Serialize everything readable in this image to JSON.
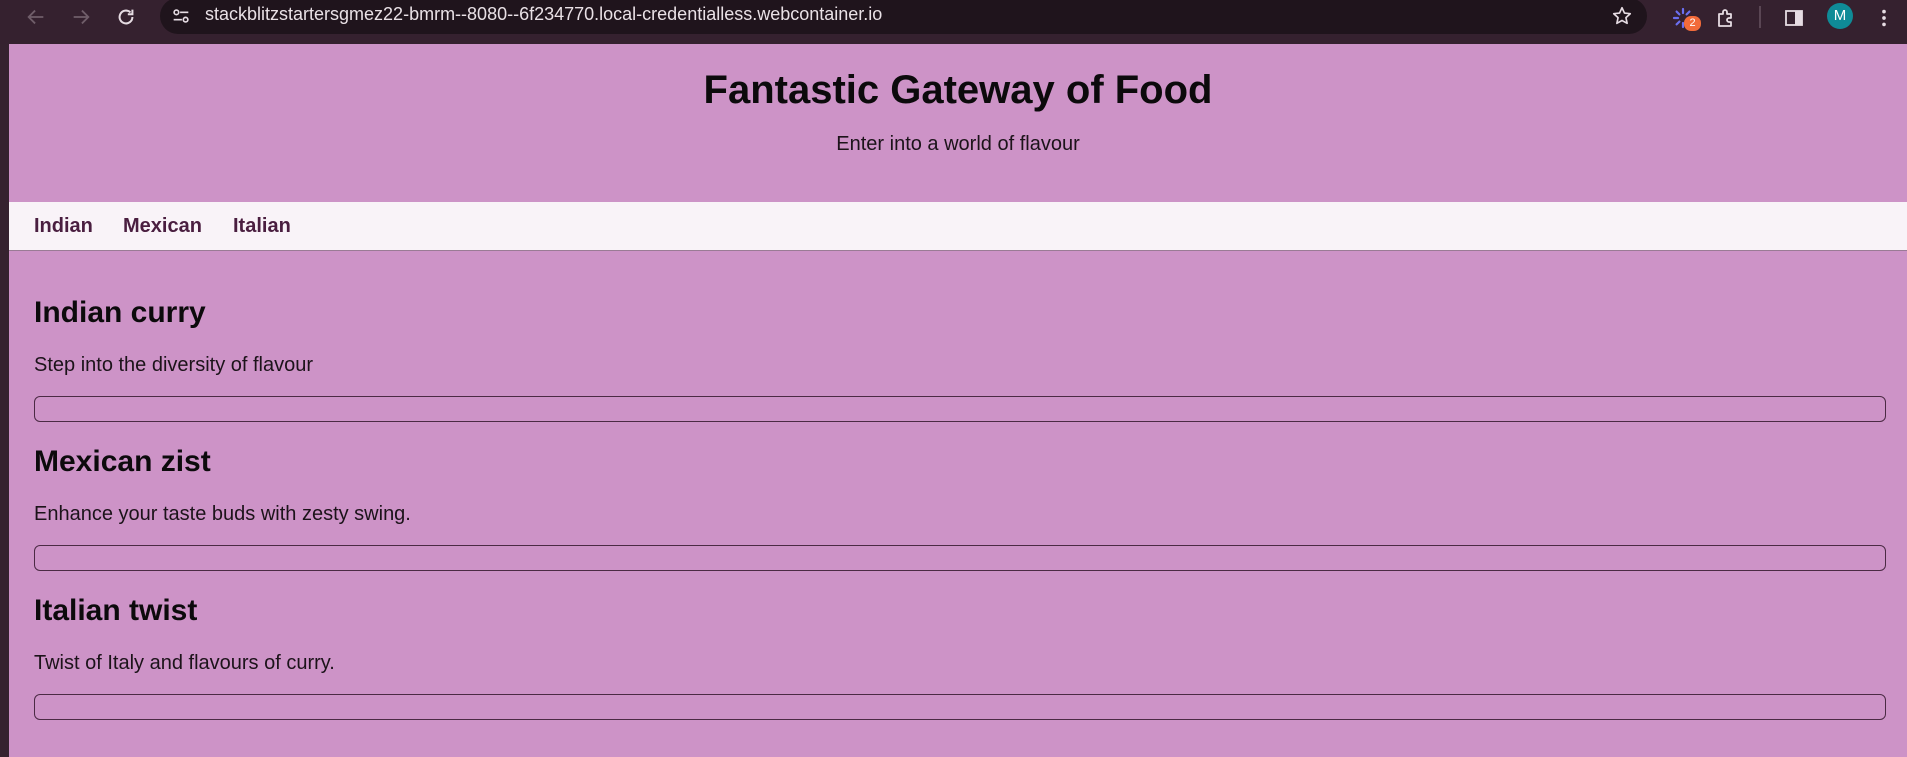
{
  "browser": {
    "url": "stackblitzstartersgmez22-bmrm--8080--6f234770.local-credentialless.webcontainer.io",
    "extension_badge": "2",
    "profile_initial": "M",
    "icons": [
      "back-arrow-icon",
      "forward-arrow-icon",
      "reload-icon",
      "site-info-icon",
      "star-icon",
      "extension-spinner-icon",
      "puzzle-icon",
      "side-panel-icon",
      "more-vert-icon"
    ]
  },
  "page": {
    "title": "Fantastic Gateway of Food",
    "subtitle": "Enter into a world of flavour",
    "nav": [
      "Indian",
      "Mexican",
      "Italian"
    ],
    "sections": [
      {
        "heading": "Indian curry",
        "text": "Step into the diversity of flavour"
      },
      {
        "heading": "Mexican zist",
        "text": "Enhance your taste buds with zesty swing."
      },
      {
        "heading": "Italian twist",
        "text": "Twist of Italy and flavours of curry."
      }
    ]
  },
  "colors": {
    "page_background": "#cd93c7",
    "nav_background": "#f9f3f8",
    "nav_link": "#4a1e40",
    "chrome_background": "#35212f"
  }
}
